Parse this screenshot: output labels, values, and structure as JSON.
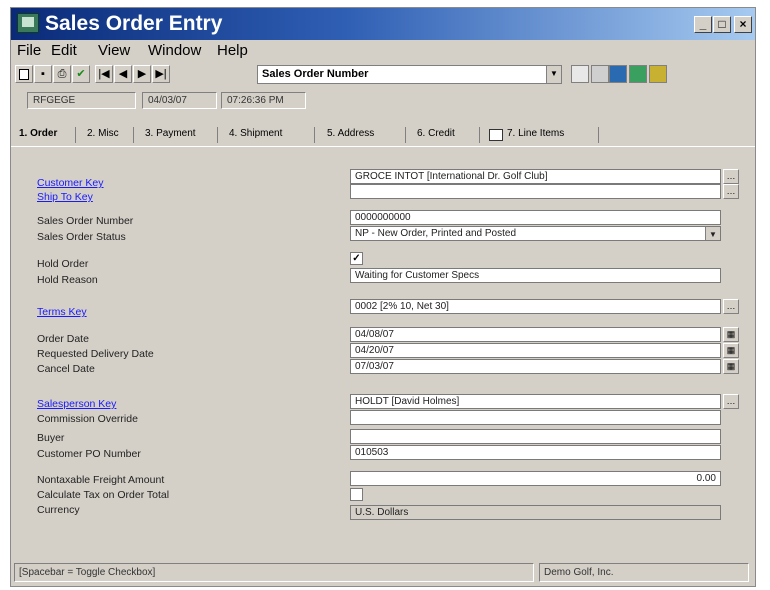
{
  "window": {
    "title": "Sales Order Entry"
  },
  "menu": [
    "File",
    "Edit",
    "View",
    "Window",
    "Help"
  ],
  "toolbar": {
    "search_value": "Sales Order Number",
    "buttons": {
      "new": "new-doc-icon",
      "save": "save-icon",
      "print": "print-icon",
      "finish": "checkmark-icon"
    }
  },
  "status_row": {
    "user": "RFGEGE",
    "date": "04/03/07",
    "time": "07:26:36 PM"
  },
  "tabs": [
    "1. Order",
    "2. Misc",
    "3. Payment",
    "4. Shipment",
    "5. Address",
    "6. Credit",
    "7. Line Items"
  ],
  "form": {
    "customer_key": {
      "label": "Customer Key",
      "value": "GROCE INTOT [International Dr. Golf Club]"
    },
    "ship_to_key": {
      "label": "Ship To Key",
      "value": ""
    },
    "sales_order_number": {
      "label": "Sales Order Number",
      "value": "0000000000"
    },
    "sales_order_status": {
      "label": "Sales Order Status",
      "value": "NP - New Order, Printed and Posted"
    },
    "hold_order": {
      "label": "Hold Order",
      "checked": true
    },
    "hold_reason": {
      "label": "Hold Reason",
      "value": "Waiting for Customer Specs"
    },
    "terms_key": {
      "label": "Terms Key",
      "value": "0002 [2% 10, Net 30]"
    },
    "order_date": {
      "label": "Order Date",
      "value": "04/08/07"
    },
    "requested_delivery_date": {
      "label": "Requested Delivery Date",
      "value": "04/20/07"
    },
    "cancel_date": {
      "label": "Cancel Date",
      "value": "07/03/07"
    },
    "salesperson_key": {
      "label": "Salesperson Key",
      "value": "HOLDT [David Holmes]"
    },
    "commission_override": {
      "label": "Commission Override",
      "value": ""
    },
    "buyer": {
      "label": "Buyer",
      "value": ""
    },
    "customer_po_number": {
      "label": "Customer PO Number",
      "value": "010503"
    },
    "nontaxable_freight": {
      "label": "Nontaxable Freight Amount",
      "value": "0.00"
    },
    "calc_tax": {
      "label": "Calculate Tax on Order Total",
      "checked": false
    },
    "currency": {
      "label": "Currency",
      "value": "U.S. Dollars"
    }
  },
  "statusbar": {
    "hint": "[Spacebar = Toggle Checkbox]",
    "company": "Demo Golf, Inc."
  }
}
